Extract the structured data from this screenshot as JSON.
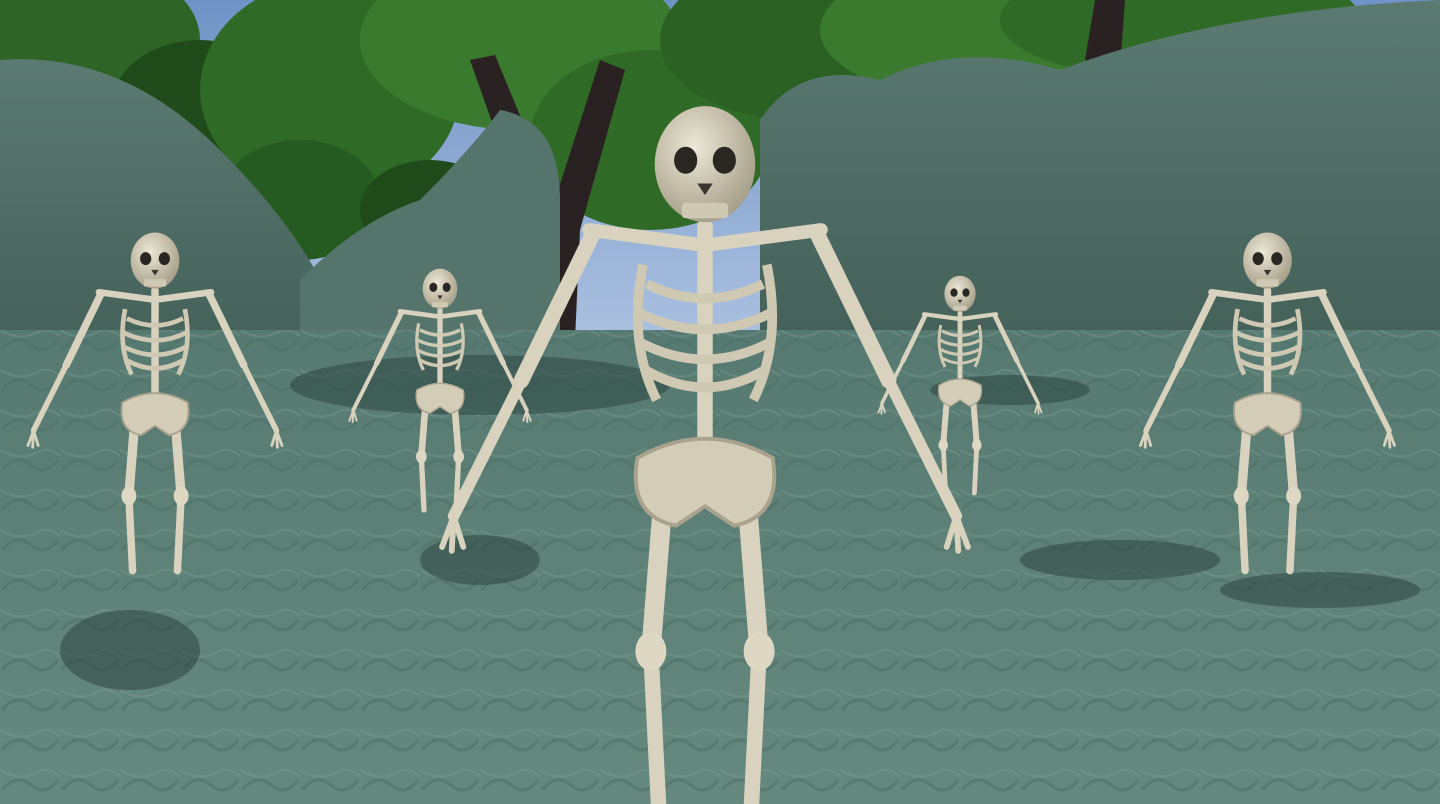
{
  "scene": {
    "description_title": "",
    "palette": {
      "sky": "#9fb8dc",
      "sky_top": "#6f93c6",
      "foliage_dark": "#1f4a1a",
      "foliage_mid": "#2f6a26",
      "foliage_light": "#4c8d3a",
      "trunk": "#2a2222",
      "hill": "#4c6a62",
      "hill_light": "#6c8a80",
      "ground": "#5f837a",
      "ground_dark": "#47665e",
      "bone": "#d8d2bf",
      "bone_shade": "#a9a28c",
      "shadow": "#2e4641"
    },
    "skeletons": [
      {
        "id": "left-far"
      },
      {
        "id": "center-left"
      },
      {
        "id": "front-center"
      },
      {
        "id": "center-right"
      },
      {
        "id": "right-far"
      }
    ]
  }
}
